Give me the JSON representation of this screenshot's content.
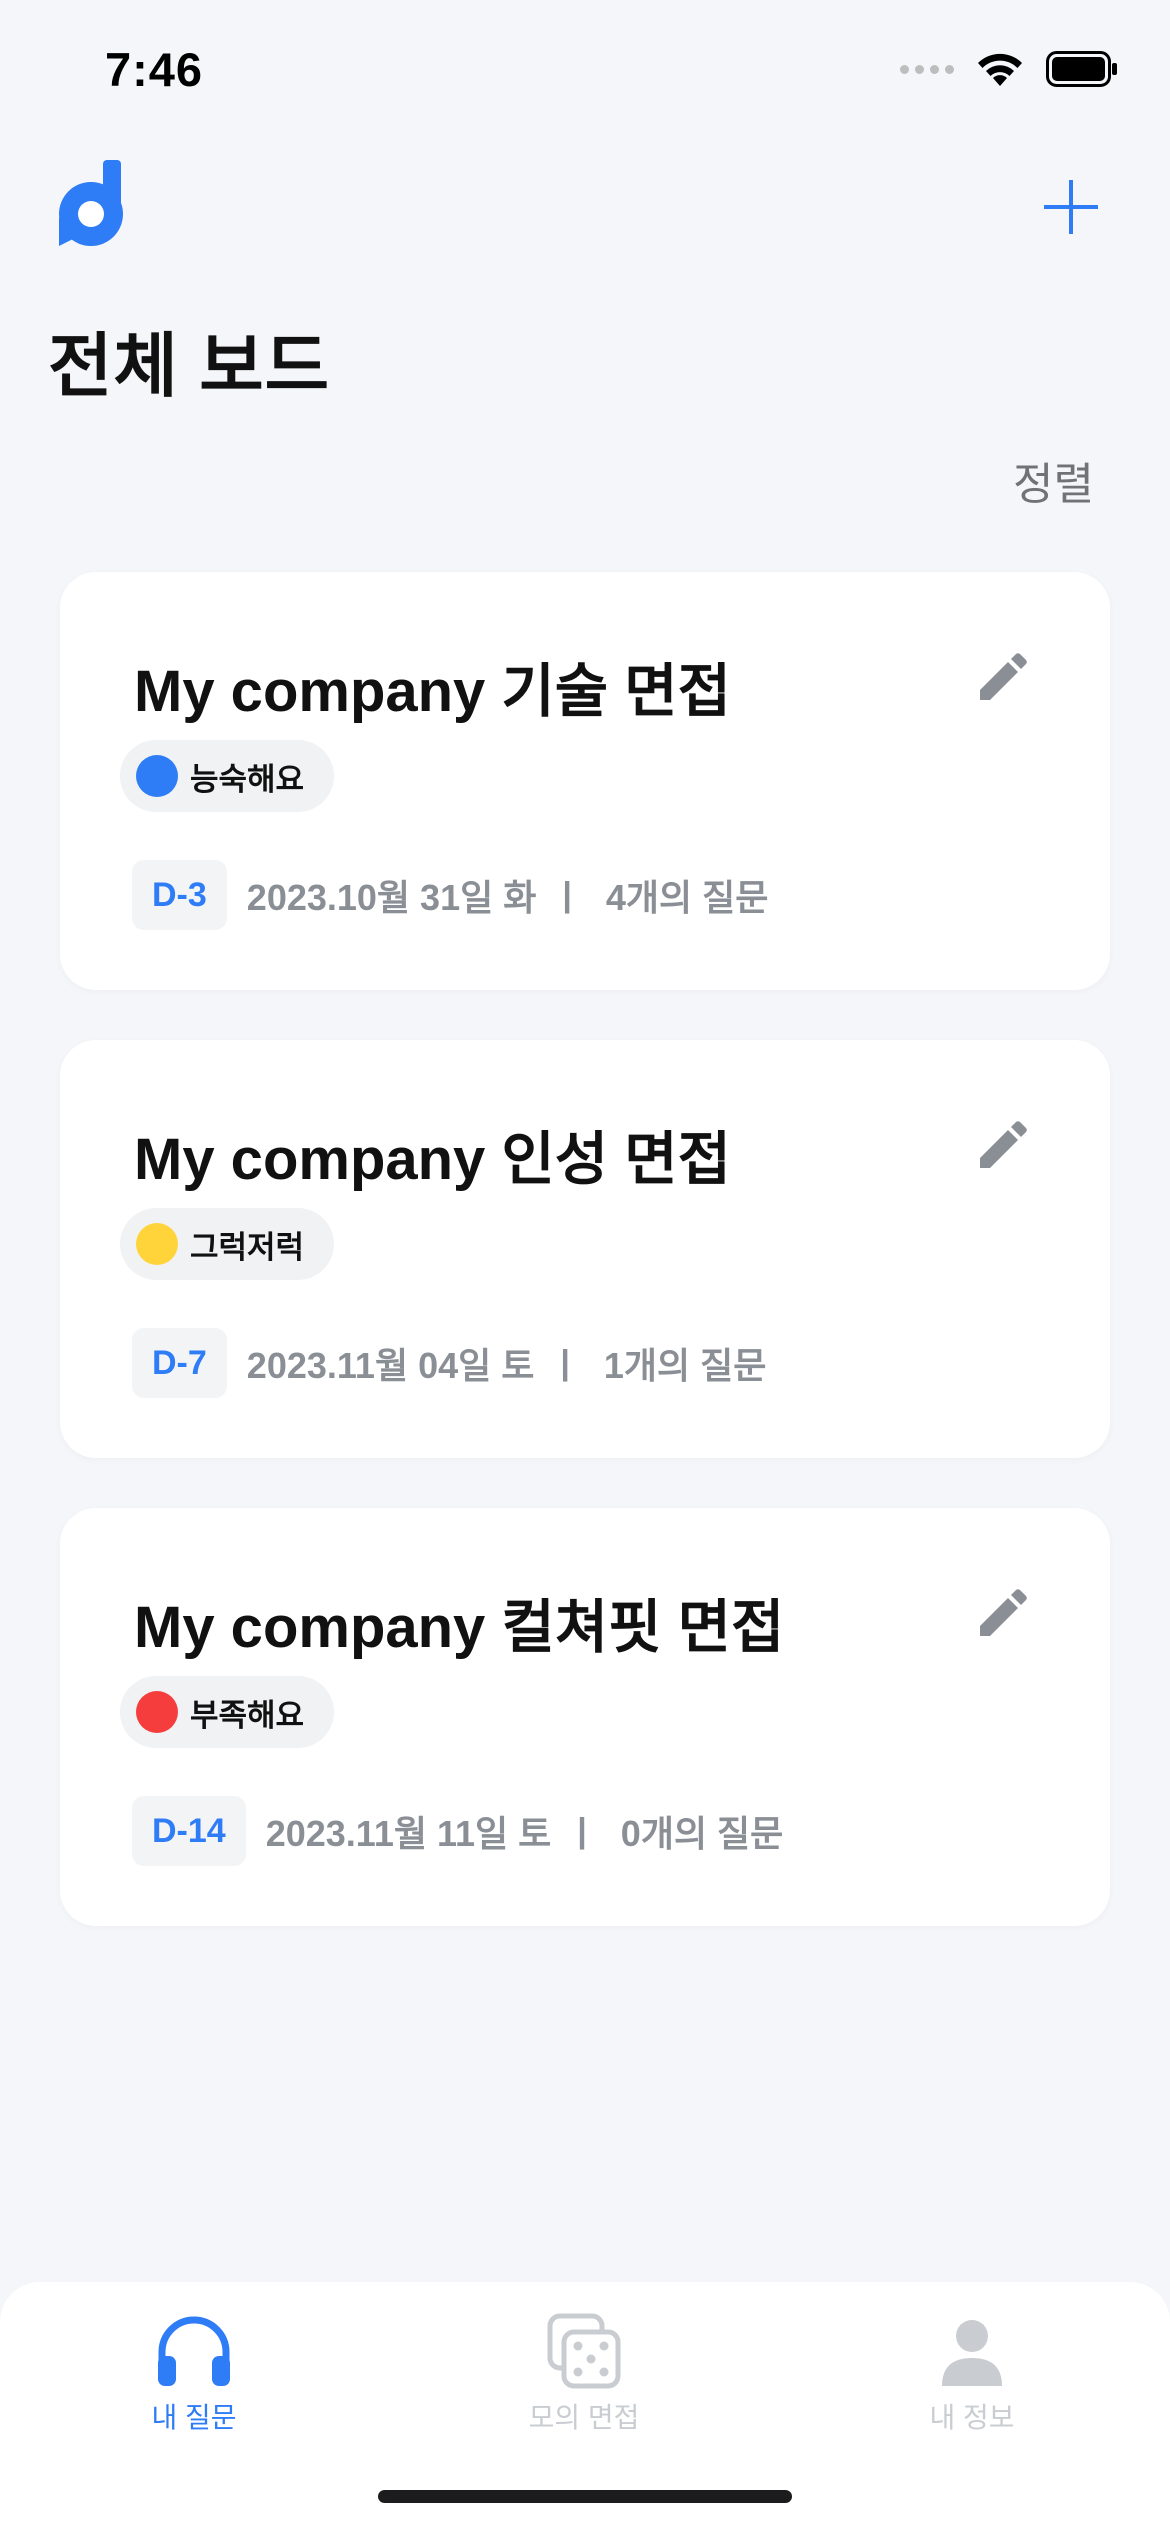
{
  "status_bar": {
    "time": "7:46"
  },
  "header": {
    "title": "전체 보드",
    "sort_label": "정렬",
    "add_icon": "plus-icon",
    "logo_icon": "app-logo-d"
  },
  "colors": {
    "accent": "#2e7cf6",
    "background": "#f5f6fa",
    "level_good": "#2e7cf6",
    "level_ok": "#ffd43b",
    "level_bad": "#f53d3d",
    "tab_inactive": "#c9ccd1"
  },
  "boards": [
    {
      "title": "My company 기술 면접",
      "level": "능숙해요",
      "level_color": "#2e7cf6",
      "dday": "D-3",
      "date": "2023.10월 31일 화",
      "separator": "|",
      "question_count": "4개의 질문"
    },
    {
      "title": "My company 인성 면접",
      "level": "그럭저럭",
      "level_color": "#ffd43b",
      "dday": "D-7",
      "date": "2023.11월 04일 토",
      "separator": "|",
      "question_count": "1개의 질문"
    },
    {
      "title": "My company 컬쳐핏 면접",
      "level": "부족해요",
      "level_color": "#f53d3d",
      "dday": "D-14",
      "date": "2023.11월 11일 토",
      "separator": "|",
      "question_count": "0개의 질문"
    }
  ],
  "tabs": [
    {
      "label": "내 질문",
      "icon": "headphones-icon",
      "active": true
    },
    {
      "label": "모의 면접",
      "icon": "dice-icon",
      "active": false
    },
    {
      "label": "내 정보",
      "icon": "person-icon",
      "active": false
    }
  ]
}
